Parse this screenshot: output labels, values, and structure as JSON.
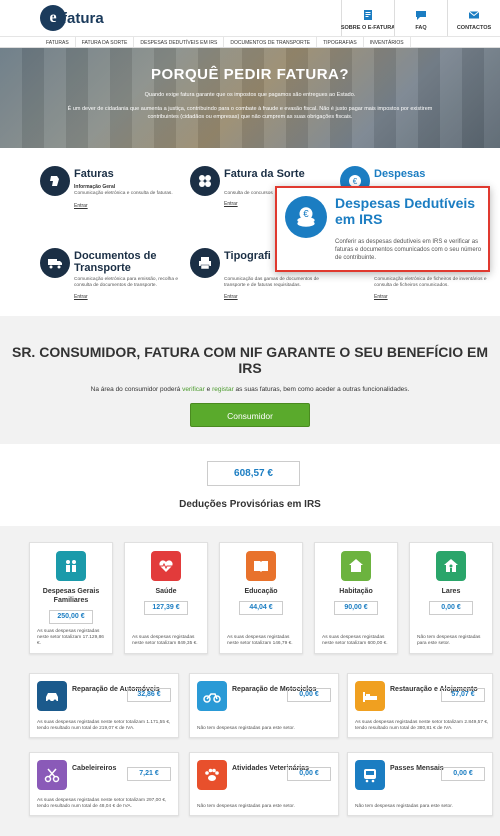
{
  "header": {
    "logo_mark": "e",
    "logo_text": "fatura",
    "nav": [
      {
        "label": "SOBRE O E-FATURA",
        "icon": "document-icon"
      },
      {
        "label": "FAQ",
        "icon": "chat-icon"
      },
      {
        "label": "CONTACTOS",
        "icon": "envelope-icon"
      }
    ]
  },
  "menu": [
    "FATURAS",
    "FATURA DA SORTE",
    "DESPESAS DEDUTÍVEIS EM IRS",
    "DOCUMENTOS DE TRANSPORTE",
    "TIPOGRAFIAS",
    "INVENTÁRIOS"
  ],
  "hero": {
    "title": "PORQUÊ PEDIR FATURA?",
    "line1": "Quando exige fatura garante que os impostos que pagamos são entregues ao Estado.",
    "line2": "É um dever de cidadania que aumenta a justiça, contribuindo para o combate à fraude e evasão fiscal. Não é justo pagar mais impostos por existirem contribuintes (cidadãos ou empresas) que não cumprem as suas obrigações fiscais."
  },
  "services": [
    {
      "title": "Faturas",
      "sub": "Informação Geral",
      "desc": "Comunicação eletrónica e consulta de faturas.",
      "link": "Entrar",
      "icon": "map-pin-icon"
    },
    {
      "title": "Fatura da Sorte",
      "sub": "",
      "desc": "Consulta de concursos",
      "link": "Entrar",
      "icon": "clover-icon"
    },
    {
      "title": "Despesas",
      "sub": "",
      "desc": "",
      "link": "",
      "icon": "euro-coins-icon"
    },
    {
      "title": "Documentos de Transporte",
      "sub": "",
      "desc": "Comunicação eletrónica para emissão, recolha e consulta de documentos de transporte.",
      "link": "Entrar",
      "icon": "truck-icon"
    },
    {
      "title": "Tipografi",
      "sub": "",
      "desc": "Comunicação das gamas de documentos de transporte e de faturas requisitadas.",
      "link": "Entrar",
      "icon": "printer-icon"
    },
    {
      "title": "",
      "sub": "",
      "desc": "Comunicação eletrónica de ficheiros de inventários e consulta de ficheiros comunicados.",
      "link": "Entrar",
      "icon": "boxes-icon"
    }
  ],
  "popup": {
    "title": "Despesas Dedutíveis em IRS",
    "desc": "Conferir as despesas dedutíveis em IRS e verificar as faturas e documentos comunicados com o seu número de contribuinte."
  },
  "consumer": {
    "title": "SR. CONSUMIDOR, FATURA COM NIF GARANTE O SEU BENEFÍCIO EM IRS",
    "text_a": "Na área do consumidor poderá ",
    "verify": "verificar",
    "text_b": " e ",
    "register": "registar",
    "text_c": " as suas faturas, bem como aceder a outras funcionalidades.",
    "button": "Consumidor"
  },
  "deductions": {
    "total": "608,57 €",
    "title": "Deduções Provisórias em IRS",
    "top": [
      {
        "name": "Despesas Gerais Familiares",
        "value": "250,00 €",
        "desc": "As suas despesas registadas neste setor totalizam 17.129,86 €.",
        "color": "#1b9aaa",
        "icon": "family-icon"
      },
      {
        "name": "Saúde",
        "value": "127,39 €",
        "desc": "As suas despesas registadas neste setor totalizam 849,35 €.",
        "color": "#e23b3b",
        "icon": "heart-monitor-icon"
      },
      {
        "name": "Educação",
        "value": "44,04 €",
        "desc": "As suas despesas registadas neste setor totalizam 146,79 €.",
        "color": "#e8722c",
        "icon": "book-icon"
      },
      {
        "name": "Habitação",
        "value": "90,00 €",
        "desc": "As suas despesas registadas neste setor totalizam 600,00 €.",
        "color": "#6cb33f",
        "icon": "house-icon"
      },
      {
        "name": "Lares",
        "value": "0,00 €",
        "desc": "Não tem despesas registadas para este setor.",
        "color": "#2aa56a",
        "icon": "home-person-icon"
      }
    ],
    "wide": [
      {
        "name": "Reparação de Automóveis",
        "value": "32,86 €",
        "desc": "As suas despesas registadas neste setor totalizam 1.171,55 €, tendo resultado num total de 219,07 € de IVA.",
        "color": "#1b5a8c",
        "icon": "car-icon"
      },
      {
        "name": "Reparação de Motociclos",
        "value": "0,00 €",
        "desc": "Não tem despesas registadas para este setor.",
        "color": "#2a9ad6",
        "icon": "motorcycle-icon"
      },
      {
        "name": "Restauração e Alojamento",
        "value": "57,07 €",
        "desc": "As suas despesas registadas neste setor totalizam 2.849,57 €, tendo resultado num total de 380,81 € de IVA.",
        "color": "#f0a020",
        "icon": "bed-icon"
      },
      {
        "name": "Cabeleireiros",
        "value": "7,21 €",
        "desc": "As suas despesas registadas neste setor totalizam 297,00 €, tendo resultado num total de 48,04 € de IVA.",
        "color": "#8a5ab8",
        "icon": "scissors-icon"
      },
      {
        "name": "Atividades Veterinárias",
        "value": "0,00 €",
        "desc": "Não tem despesas registadas para este setor.",
        "color": "#e8502c",
        "icon": "paw-icon"
      },
      {
        "name": "Passes Mensais",
        "value": "0,00 €",
        "desc": "Não tem despesas registadas para este setor.",
        "color": "#1b7dc2",
        "icon": "bus-icon"
      }
    ]
  }
}
